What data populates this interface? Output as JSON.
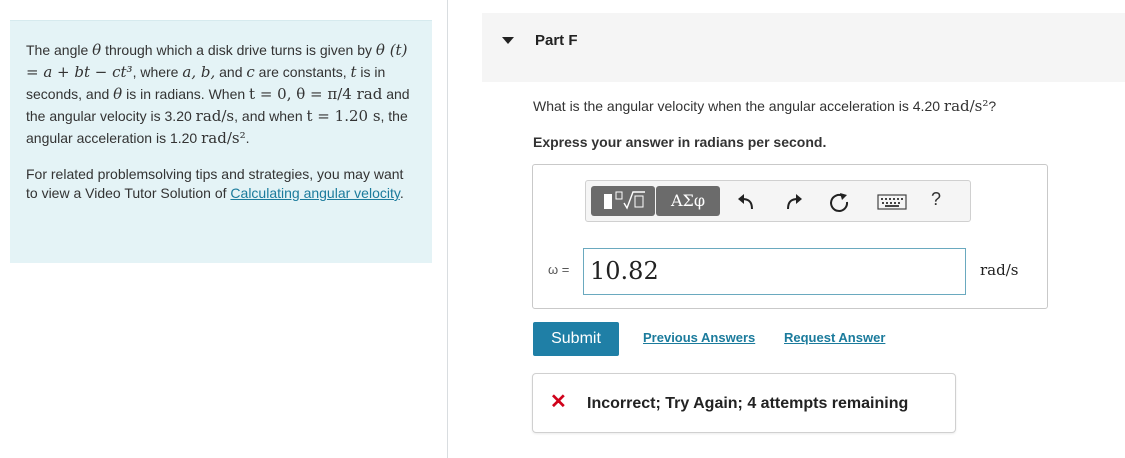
{
  "info": {
    "p1": {
      "t1": "The angle ",
      "theta": "θ",
      "t2": " through which a disk drive turns is given by ",
      "eq": "θ (t) = a + bt − ct³",
      "t3": ", where ",
      "abc": "a, b,",
      "t4": " and ",
      "c": "c",
      "t5": " are constants, ",
      "t": "t",
      "t6": " is in seconds, and ",
      "t7": " is in radians. When ",
      "cond1": "t = 0, θ = π/4 rad",
      "t8": " and the angular velocity is 3.20 ",
      "u1": "rad/s",
      "t9": ", and when ",
      "cond2": "t = 1.20 s",
      "t10": ", the angular acceleration is 1.20 ",
      "u2": "rad/s²",
      "t11": "."
    },
    "p2_text": "For related problemsolving tips and strategies, you may want to view a Video Tutor Solution of ",
    "p2_link": "Calculating angular velocity",
    "p2_end": "."
  },
  "part": {
    "title": "Part F"
  },
  "question": {
    "text": "What is the angular velocity when the angular acceleration is 4.20 ",
    "unit": "rad/s²",
    "end": "?"
  },
  "instruction": "Express your answer in radians per second.",
  "toolbar": {
    "greek_label": "ΑΣφ",
    "help_label": "?",
    "icons": [
      "templates-icon",
      "undo-icon",
      "redo-icon",
      "reset-icon",
      "keyboard-icon",
      "help-icon"
    ]
  },
  "answer": {
    "variable_label": "ω =",
    "value": "10.82",
    "unit": "rad/s"
  },
  "actions": {
    "submit": "Submit",
    "previous": "Previous Answers",
    "request": "Request Answer"
  },
  "feedback": {
    "icon": "✕",
    "text": "Incorrect; Try Again; 4 attempts remaining",
    "color": "#d0021b"
  },
  "colors": {
    "accent": "#1f7fa6",
    "link": "#1b7b9c",
    "info_bg": "#e4f3f6"
  }
}
